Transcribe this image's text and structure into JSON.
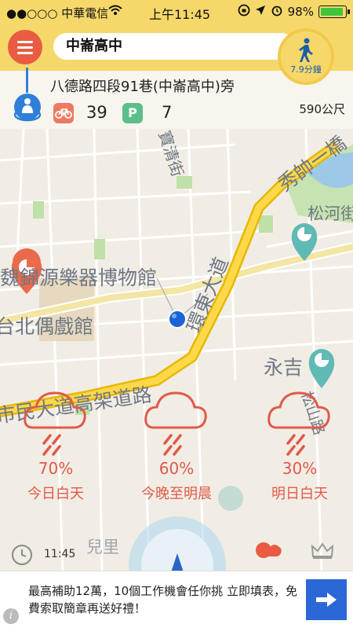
{
  "status_bar": {
    "carrier": "●●○○○ 中華電信",
    "time": "上午11:45",
    "battery": "98%"
  },
  "header": {
    "search_value": "中崙高中",
    "walk_time": "7.9分鐘"
  },
  "station": {
    "address": "八德路四段91巷(中崙高中)旁",
    "distance": "590公尺",
    "bikes": "39",
    "parking": "7",
    "parking_badge": "P"
  },
  "map": {
    "labels": {
      "museum": "魏錦源樂器博物館",
      "puppet": "台北偶戲館",
      "road_bridge": "市民大道高架道路",
      "huandong": "環東大道",
      "xiushuai": "秀帥一橋",
      "baoqing": "寶清街",
      "yongji": "永吉",
      "songhe": "松河街",
      "songshan": "松山路",
      "ertong": "兒里"
    }
  },
  "weather": [
    {
      "pct": "70%",
      "period": "今日白天"
    },
    {
      "pct": "60%",
      "period": "今晚至明晨"
    },
    {
      "pct": "30%",
      "period": "明日白天"
    }
  ],
  "bottom": {
    "time": "11:45"
  },
  "ad": {
    "text": "最高補助12萬，10個工作機會任你挑 立即填表，免費索取簡章再送好禮！",
    "info_icon": "i"
  },
  "colors": {
    "header_yellow": "#f6d86a",
    "accent_red": "#e95b42",
    "station_blue": "#2f7fd8",
    "weather_red": "#e05a4a",
    "ad_blue": "#2b67d6"
  }
}
